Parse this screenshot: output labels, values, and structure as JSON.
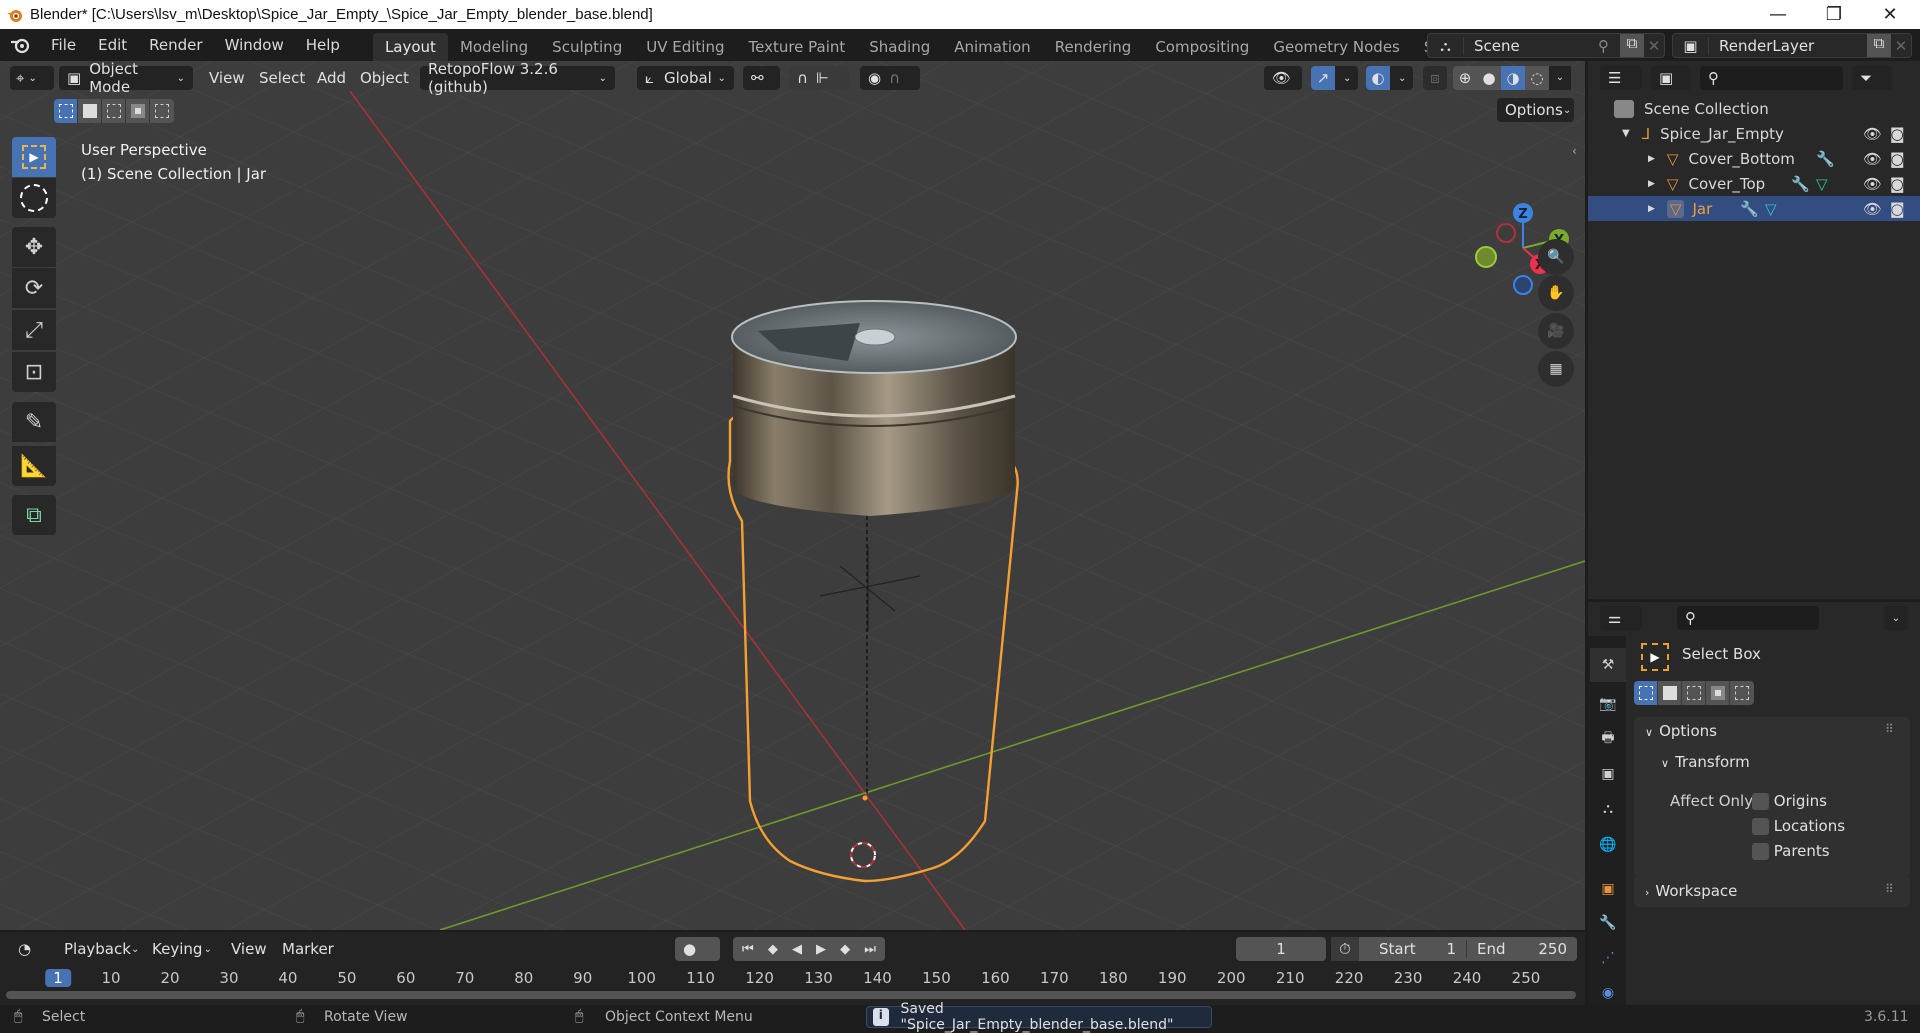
{
  "window": {
    "title": "Blender* [C:\\Users\\lsv_m\\Desktop\\Spice_Jar_Empty_\\Spice_Jar_Empty_blender_base.blend]",
    "controls": {
      "minimize": "—",
      "maximize": "❐",
      "close": "✕"
    }
  },
  "menubar": {
    "items": [
      "File",
      "Edit",
      "Render",
      "Window",
      "Help"
    ]
  },
  "workspaces": {
    "tabs": [
      "Layout",
      "Modeling",
      "Sculpting",
      "UV Editing",
      "Texture Paint",
      "Shading",
      "Animation",
      "Rendering",
      "Compositing",
      "Geometry Nodes",
      "Scripting"
    ],
    "active": "Layout",
    "add_label": "+"
  },
  "scene_selector": {
    "value": "Scene"
  },
  "view_layer_selector": {
    "value": "RenderLayer"
  },
  "viewport": {
    "header": {
      "mode": "Object Mode",
      "menus": [
        "View",
        "Select",
        "Add",
        "Object"
      ],
      "addon_menu": "RetopoFlow 3.2.6 (github)",
      "orientation": "Global",
      "options_label": "Options"
    },
    "overlay_text": {
      "line1": "User Perspective",
      "line2": "(1) Scene Collection | Jar"
    },
    "gizmo_axes": {
      "z": "Z",
      "y": "Y",
      "x": "X"
    },
    "tools": [
      "select-box",
      "cursor",
      "move",
      "rotate",
      "scale",
      "transform",
      "annotate",
      "measure",
      "add-cube"
    ],
    "colors": {
      "selection_outline": "#f5a030",
      "x_axis": "#c8303a",
      "y_axis": "#7cab2c",
      "active_blue": "#4772b3"
    }
  },
  "outliner": {
    "root": "Scene Collection",
    "items": [
      {
        "name": "Spice_Jar_Empty",
        "type": "empty",
        "level": 0,
        "expanded": true
      },
      {
        "name": "Cover_Bottom",
        "type": "mesh",
        "level": 1,
        "modifier": true,
        "data": false
      },
      {
        "name": "Cover_Top",
        "type": "mesh",
        "level": 1,
        "modifier": true,
        "data": true
      },
      {
        "name": "Jar",
        "type": "mesh",
        "level": 1,
        "modifier": true,
        "data": true,
        "selected": true
      }
    ]
  },
  "properties": {
    "tool_name": "Select Box",
    "sections": {
      "options": "Options",
      "transform": "Transform",
      "affect_only_label": "Affect Only",
      "checkboxes": [
        {
          "label": "Origins",
          "checked": false
        },
        {
          "label": "Locations",
          "checked": false
        },
        {
          "label": "Parents",
          "checked": false
        }
      ],
      "workspace": "Workspace"
    }
  },
  "timeline": {
    "menus": [
      "Playback",
      "Keying",
      "View",
      "Marker"
    ],
    "current_frame": "1",
    "start_label": "Start",
    "start": "1",
    "end_label": "End",
    "end": "250",
    "ruler": [
      "1",
      "10",
      "20",
      "30",
      "40",
      "50",
      "60",
      "70",
      "80",
      "90",
      "100",
      "110",
      "120",
      "130",
      "140",
      "150",
      "160",
      "170",
      "180",
      "190",
      "200",
      "210",
      "220",
      "230",
      "240",
      "250"
    ]
  },
  "statusbar": {
    "select": "Select",
    "rotate": "Rotate View",
    "context": "Object Context Menu",
    "message": "Saved \"Spice_Jar_Empty_blender_base.blend\"",
    "version": "3.6.11"
  }
}
